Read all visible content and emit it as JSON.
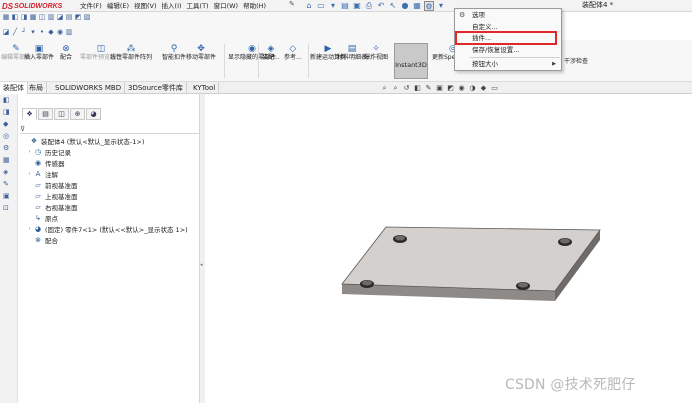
{
  "app": {
    "logo_ds": "DS",
    "logo_name": "SOLIDWORKS",
    "doc_title": "装配体4 *"
  },
  "menu": {
    "items": [
      "文件(F)",
      "编辑(E)",
      "视图(V)",
      "插入(I)",
      "工具(T)",
      "窗口(W)",
      "帮助(H)"
    ]
  },
  "commands": [
    {
      "label": "编辑零部件",
      "icon": "edit-component-icon"
    },
    {
      "label": "插入零部件",
      "icon": "insert-component-icon"
    },
    {
      "label": "配合",
      "icon": "mate-icon"
    },
    {
      "label": "零部件预览窗口",
      "icon": "component-preview-icon"
    },
    {
      "label": "线性零部件阵列",
      "icon": "linear-pattern-icon"
    },
    {
      "label": "智能扣件",
      "icon": "smart-fastener-icon"
    },
    {
      "label": "移动零部件",
      "icon": "move-component-icon"
    },
    {
      "label": "显示隐藏的零部件",
      "icon": "show-hidden-icon"
    },
    {
      "label": "装配...",
      "icon": "assembly-feature-icon"
    },
    {
      "label": "参考...",
      "icon": "reference-geometry-icon"
    },
    {
      "label": "新建运动算例",
      "icon": "new-motion-study-icon"
    },
    {
      "label": "材料明细表",
      "icon": "bom-icon"
    },
    {
      "label": "爆炸视图",
      "icon": "exploded-view-icon"
    },
    {
      "label": "Instant3D",
      "icon": "instant3d-icon"
    },
    {
      "label": "更新Speedpak",
      "icon": "speedpak-icon"
    },
    {
      "label": "保存/恢复",
      "icon": "save-restore-icon"
    },
    {
      "label": "零部件",
      "icon": "component-icon"
    },
    {
      "label": "干涉检查",
      "icon": "interference-icon"
    }
  ],
  "tabs": [
    "装配体",
    "布局",
    "SOLIDWORKS MBD",
    "3DSource零件库",
    "KYTool"
  ],
  "tree": {
    "filter_icon": "filter-icon",
    "nodes": [
      {
        "label": "装配体4  (默认<默认_显示状态-1>)",
        "indent": 0,
        "expand": "",
        "icon": "assembly-icon"
      },
      {
        "label": "历史记录",
        "indent": 1,
        "expand": "›",
        "icon": "history-icon"
      },
      {
        "label": "传感器",
        "indent": 1,
        "expand": "",
        "icon": "sensor-icon"
      },
      {
        "label": "注解",
        "indent": 1,
        "expand": "›",
        "icon": "annotation-icon"
      },
      {
        "label": "前视基准面",
        "indent": 1,
        "expand": "",
        "icon": "plane-icon"
      },
      {
        "label": "上视基准面",
        "indent": 1,
        "expand": "",
        "icon": "plane-icon"
      },
      {
        "label": "右视基准面",
        "indent": 1,
        "expand": "",
        "icon": "plane-icon"
      },
      {
        "label": "原点",
        "indent": 1,
        "expand": "",
        "icon": "origin-icon"
      },
      {
        "label": "(固定) 零件7<1> (默认<<默认>_显示状态 1>)",
        "indent": 1,
        "expand": "›",
        "icon": "part-icon"
      },
      {
        "label": "配合",
        "indent": 1,
        "expand": "",
        "icon": "mates-folder-icon"
      }
    ]
  },
  "options_menu": {
    "items": [
      {
        "label": "选项",
        "icon": "gear-icon",
        "submenu": false
      },
      {
        "label": "自定义...",
        "icon": "",
        "submenu": false
      },
      {
        "label": "插件...",
        "icon": "",
        "submenu": false,
        "highlighted": true
      },
      {
        "label": "保存/恢复设置...",
        "icon": "",
        "submenu": false
      },
      {
        "label": "按钮大小",
        "icon": "",
        "submenu": true
      }
    ]
  },
  "watermark": "CSDN @技术死肥仔",
  "colors": {
    "brand": "#d8202a",
    "highlight": "#e02a2a",
    "plate_top": "#d4d0cd",
    "plate_side": "#8e8a87"
  }
}
